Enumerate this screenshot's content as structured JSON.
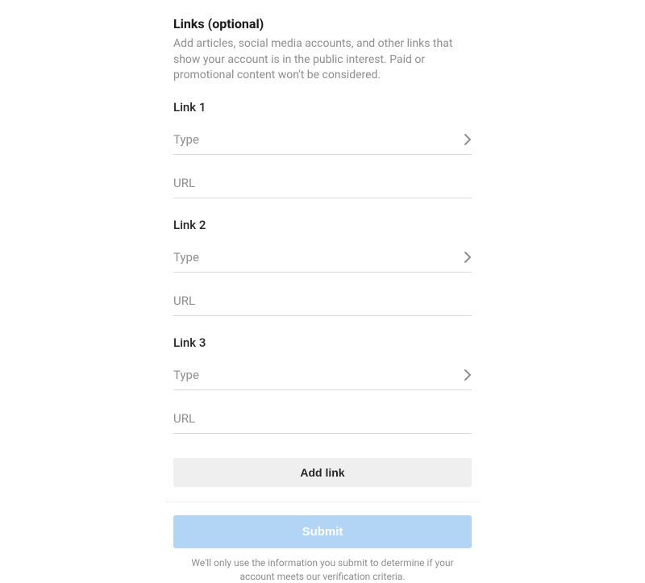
{
  "section": {
    "title": "Links (optional)",
    "description": "Add articles, social media accounts, and other links that show your account is in the public interest. Paid or promotional content won't be considered."
  },
  "links": [
    {
      "label": "Link 1",
      "type_placeholder": "Type",
      "url_placeholder": "URL"
    },
    {
      "label": "Link 2",
      "type_placeholder": "Type",
      "url_placeholder": "URL"
    },
    {
      "label": "Link 3",
      "type_placeholder": "Type",
      "url_placeholder": "URL"
    }
  ],
  "buttons": {
    "add_link": "Add link",
    "submit": "Submit"
  },
  "footer_note": "We'll only use the information you submit to determine if your account meets our verification criteria."
}
